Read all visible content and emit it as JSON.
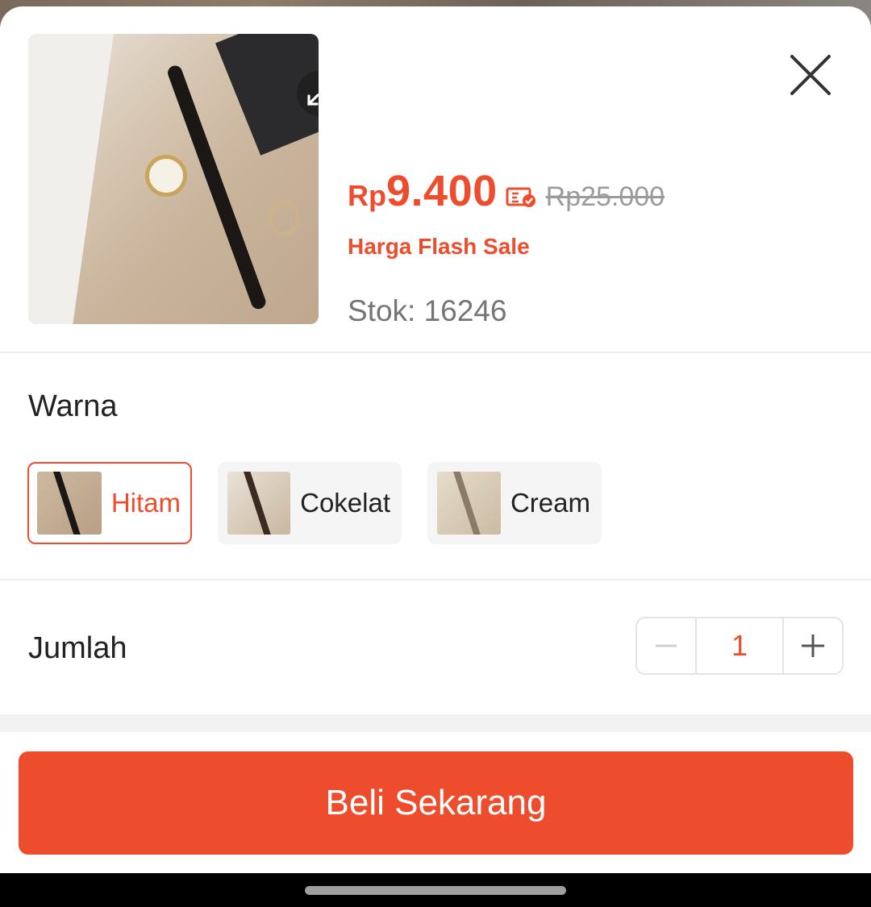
{
  "product": {
    "currency": "Rp",
    "price": "9.400",
    "original_price": "Rp25.000",
    "price_label": "Harga Flash Sale",
    "stock": "Stok: 16246",
    "expand_icon": "expand-icon",
    "close_icon": "close-icon",
    "coin_icon": "coin-check-icon"
  },
  "variation": {
    "title": "Warna",
    "options": [
      {
        "label": "Hitam",
        "selected": true
      },
      {
        "label": "Cokelat",
        "selected": false
      },
      {
        "label": "Cream",
        "selected": false
      }
    ]
  },
  "quantity": {
    "title": "Jumlah",
    "value": "1",
    "minus_icon": "minus-icon",
    "plus_icon": "plus-icon"
  },
  "actions": {
    "buy_label": "Beli Sekarang"
  },
  "colors": {
    "accent": "#ee4d2d",
    "text": "#222222",
    "muted": "#757575"
  }
}
